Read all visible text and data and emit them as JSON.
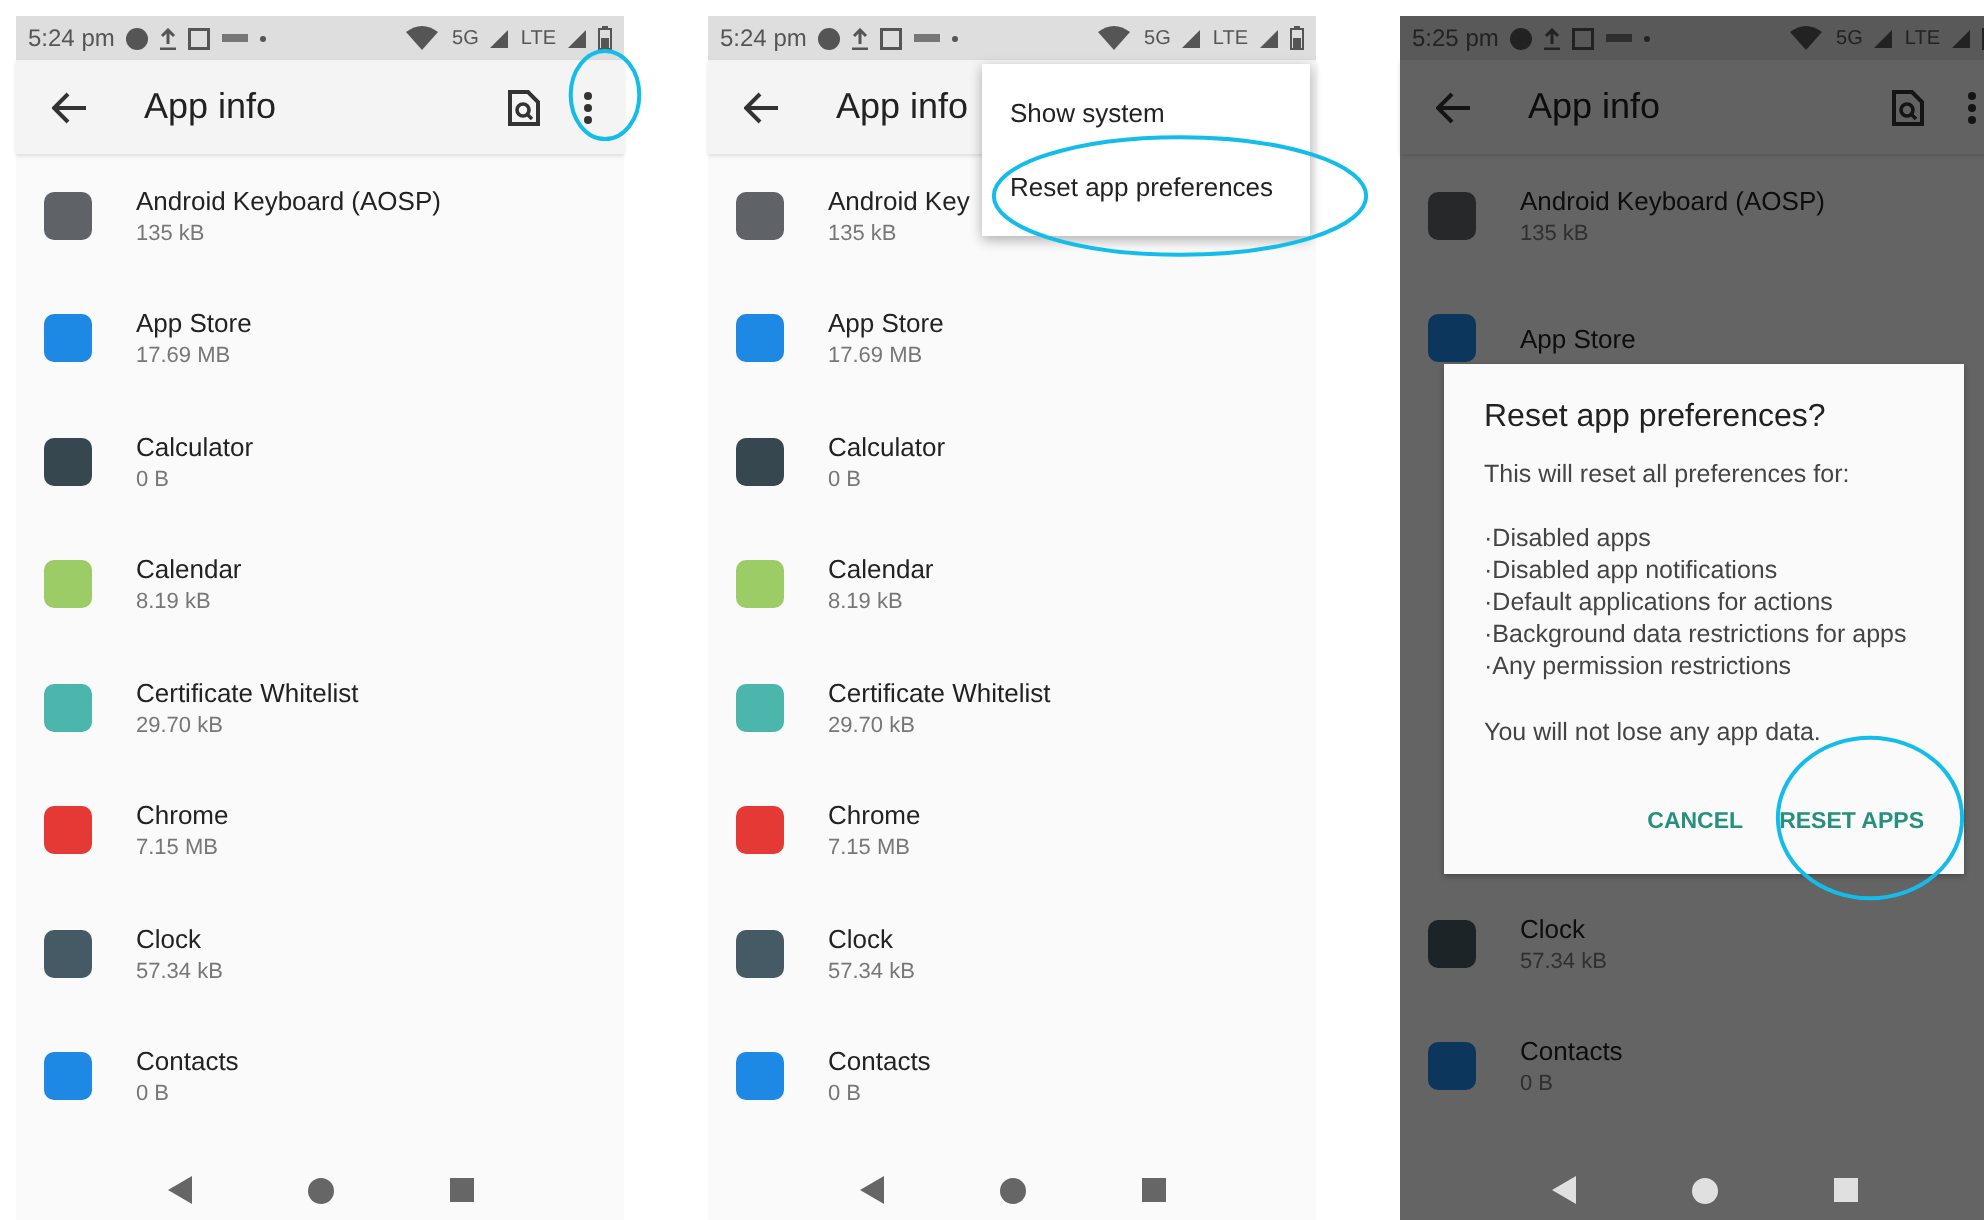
{
  "screens": [
    {
      "status_bar": {
        "time": "5:24 pm",
        "network": "5G",
        "network_2": "LTE"
      },
      "app_bar": {
        "title": "App info",
        "menu_highlighted": true
      },
      "apps": [
        {
          "name": "Android Keyboard (AOSP)",
          "size": "135 kB",
          "color": "#5f6368"
        },
        {
          "name": "App Store",
          "size": "17.69 MB",
          "color": "#1e88e5"
        },
        {
          "name": "Calculator",
          "size": "0 B",
          "color": "#37474f"
        },
        {
          "name": "Calendar",
          "size": "8.19 kB",
          "color": "#9ccc65"
        },
        {
          "name": "Certificate Whitelist",
          "size": "29.70 kB",
          "color": "#4db6ac"
        },
        {
          "name": "Chrome",
          "size": "7.15 MB",
          "color": "#e53935"
        },
        {
          "name": "Clock",
          "size": "57.34 kB",
          "color": "#455a64"
        },
        {
          "name": "Contacts",
          "size": "0 B",
          "color": "#1e88e5"
        }
      ]
    },
    {
      "status_bar": {
        "time": "5:24 pm",
        "network": "5G",
        "network_2": "LTE"
      },
      "app_bar": {
        "title": "App info",
        "menu_highlighted": false
      },
      "apps": [
        {
          "name": "Android Key",
          "size": "135 kB",
          "color": "#5f6368"
        },
        {
          "name": "App Store",
          "size": "17.69 MB",
          "color": "#1e88e5"
        },
        {
          "name": "Calculator",
          "size": "0 B",
          "color": "#37474f"
        },
        {
          "name": "Calendar",
          "size": "8.19 kB",
          "color": "#9ccc65"
        },
        {
          "name": "Certificate Whitelist",
          "size": "29.70 kB",
          "color": "#4db6ac"
        },
        {
          "name": "Chrome",
          "size": "7.15 MB",
          "color": "#e53935"
        },
        {
          "name": "Clock",
          "size": "57.34 kB",
          "color": "#455a64"
        },
        {
          "name": "Contacts",
          "size": "0 B",
          "color": "#1e88e5"
        }
      ],
      "menu": [
        {
          "label": "Show system",
          "highlighted": false
        },
        {
          "label": "Reset app preferences",
          "highlighted": true
        }
      ]
    },
    {
      "status_bar": {
        "time": "5:25 pm",
        "network": "5G",
        "network_2": "LTE"
      },
      "app_bar": {
        "title": "App info",
        "menu_highlighted": false
      },
      "apps": [
        {
          "name": "Android Keyboard (AOSP)",
          "size": "135 kB",
          "color": "#26282a"
        },
        {
          "name": "App Store",
          "color": "#0c365c"
        },
        {
          "name": "Clock",
          "size": "57.34 kB",
          "color": "#1c2428"
        },
        {
          "name": "Contacts",
          "size": "0 B",
          "color": "#0c365c"
        }
      ],
      "dialog": {
        "title": "Reset app preferences?",
        "intro": "This will reset all preferences for:",
        "bullets": [
          "·Disabled apps",
          "·Disabled app notifications",
          "·Default applications for actions",
          "·Background data restrictions for apps",
          "·Any permission restrictions"
        ],
        "note": "You will not lose any app data.",
        "buttons": [
          {
            "label": "CANCEL",
            "highlighted": false
          },
          {
            "label": "RESET APPS",
            "highlighted": true
          }
        ]
      }
    }
  ]
}
